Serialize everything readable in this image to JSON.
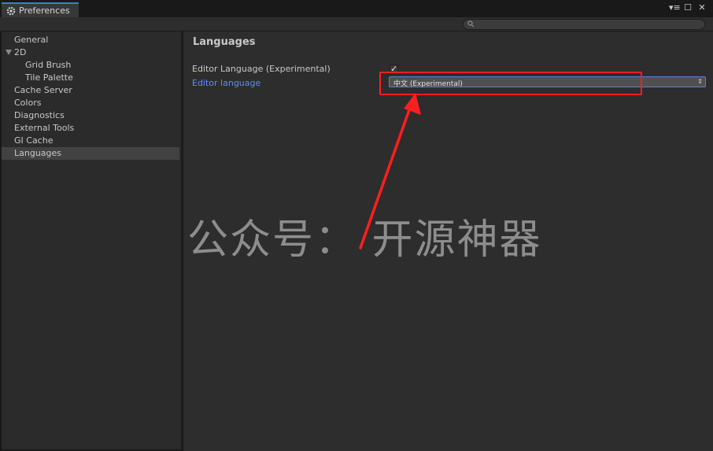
{
  "window": {
    "tab_title": "Preferences",
    "controls": [
      "menu-icon",
      "maximize-icon",
      "close-icon"
    ]
  },
  "search": {
    "placeholder": ""
  },
  "sidebar": {
    "items": [
      {
        "label": "General"
      },
      {
        "label": "2D",
        "expanded": true
      },
      {
        "label": "Grid Brush"
      },
      {
        "label": "Tile Palette"
      },
      {
        "label": "Cache Server"
      },
      {
        "label": "Colors"
      },
      {
        "label": "Diagnostics"
      },
      {
        "label": "External Tools"
      },
      {
        "label": "GI Cache"
      },
      {
        "label": "Languages",
        "selected": true
      }
    ]
  },
  "main": {
    "title": "Languages",
    "editor_language_experimental": {
      "label": "Editor Language (Experimental)",
      "checked": true
    },
    "editor_language": {
      "label": "Editor language",
      "value": "中文 (Experimental)"
    }
  },
  "watermark": {
    "text": "公众号：  开源神器"
  },
  "colors": {
    "accent": "#3d7bd6",
    "link": "#5f8ff0",
    "annotation": "#ff1e1e",
    "background": "#2d2d2d"
  }
}
